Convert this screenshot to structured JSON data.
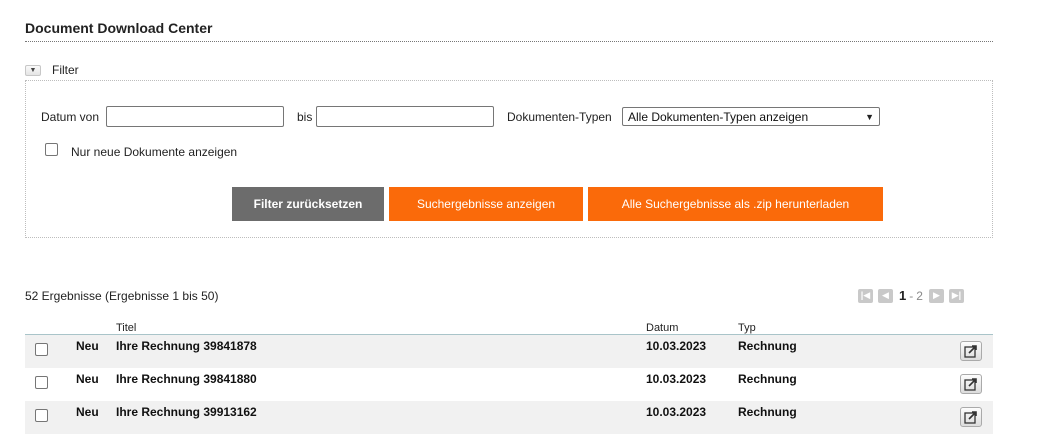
{
  "page": {
    "title": "Document Download Center"
  },
  "filter": {
    "toggle_label": "Filter",
    "date_from_label": "Datum von",
    "date_from_value": "",
    "date_to_label": "bis",
    "date_to_value": "",
    "doctype_label": "Dokumenten-Typen",
    "doctype_selected": "Alle Dokumenten-Typen anzeigen",
    "only_new_label": "Nur neue Dokumente anzeigen",
    "reset_label": "Filter zurücksetzen",
    "show_results_label": "Suchergebnisse anzeigen",
    "download_zip_label": "Alle Suchergebnisse als .zip herunterladen"
  },
  "results": {
    "summary": "52 Ergebnisse (Ergebnisse 1 bis 50)",
    "pager": {
      "current": "1",
      "separator": "-",
      "next_page": "2"
    },
    "columns": {
      "title": "Titel",
      "date": "Datum",
      "type": "Typ"
    },
    "rows": [
      {
        "status": "Neu",
        "title": "Ihre Rechnung 39841878",
        "date": "10.03.2023",
        "type": "Rechnung"
      },
      {
        "status": "Neu",
        "title": "Ihre Rechnung 39841880",
        "date": "10.03.2023",
        "type": "Rechnung"
      },
      {
        "status": "Neu",
        "title": "Ihre Rechnung 39913162",
        "date": "10.03.2023",
        "type": "Rechnung"
      }
    ]
  },
  "colors": {
    "accent_orange": "#fa6a0a",
    "button_gray": "#6c6c6c",
    "row_alt": "#f1f1f1"
  },
  "icons": [
    "chevron-down-icon",
    "first-page-icon",
    "prev-page-icon",
    "next-page-icon",
    "last-page-icon",
    "open-external-icon"
  ]
}
